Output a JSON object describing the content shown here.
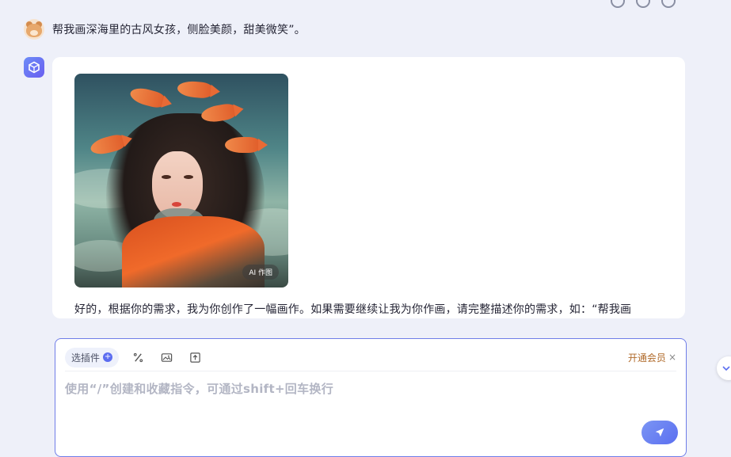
{
  "user_message": {
    "text": "帮我画深海里的古风女孩，侧脸美颜，甜美微笑”。"
  },
  "bot_message": {
    "image_badge": "AI 作图",
    "reply_text": "好的，根据你的需求，我为你创作了一幅画作。如果需要继续让我为你作画，请完整描述你的需求，如：“帮我画"
  },
  "composer": {
    "plugin_label": "选插件",
    "vip_label": "开通会员",
    "vip_close": "×",
    "placeholder": "使用“/”创建和收藏指令，可通过shift+回车换行"
  },
  "colors": {
    "accent": "#5b6ff0",
    "vip": "#b06a2a",
    "background": "#eef0f9"
  }
}
